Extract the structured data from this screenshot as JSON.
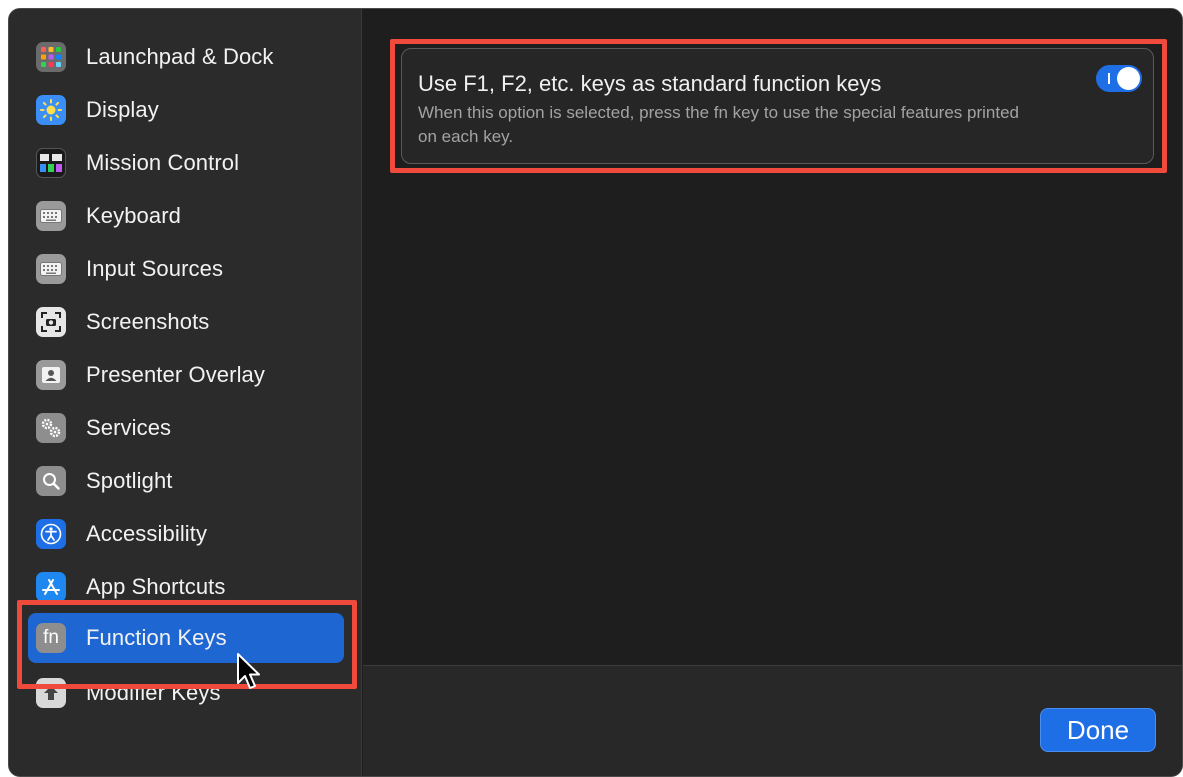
{
  "sidebar": {
    "items": [
      {
        "label": "Launchpad & Dock",
        "icon": "launchpad-icon"
      },
      {
        "label": "Display",
        "icon": "display-brightness-icon"
      },
      {
        "label": "Mission Control",
        "icon": "mission-control-icon"
      },
      {
        "label": "Keyboard",
        "icon": "keyboard-icon"
      },
      {
        "label": "Input Sources",
        "icon": "input-sources-icon"
      },
      {
        "label": "Screenshots",
        "icon": "screenshot-icon"
      },
      {
        "label": "Presenter Overlay",
        "icon": "presenter-overlay-icon"
      },
      {
        "label": "Services",
        "icon": "gears-icon"
      },
      {
        "label": "Spotlight",
        "icon": "magnifying-glass-icon"
      },
      {
        "label": "Accessibility",
        "icon": "accessibility-icon"
      },
      {
        "label": "App Shortcuts",
        "icon": "app-store-icon"
      },
      {
        "label": "Function Keys",
        "icon": "fn-key-icon",
        "selected": true,
        "icon_text": "fn"
      },
      {
        "label": "Modifier Keys",
        "icon": "modifier-keys-icon"
      }
    ]
  },
  "option": {
    "title": "Use F1, F2, etc. keys as standard function keys",
    "description": "When this option is selected, press the fn key to use the special features printed on each key.",
    "toggle_on": true
  },
  "footer": {
    "done_label": "Done"
  },
  "colors": {
    "accent": "#1e6ee6",
    "selected_row": "#1e67d2",
    "highlight": "#f04a3c"
  }
}
